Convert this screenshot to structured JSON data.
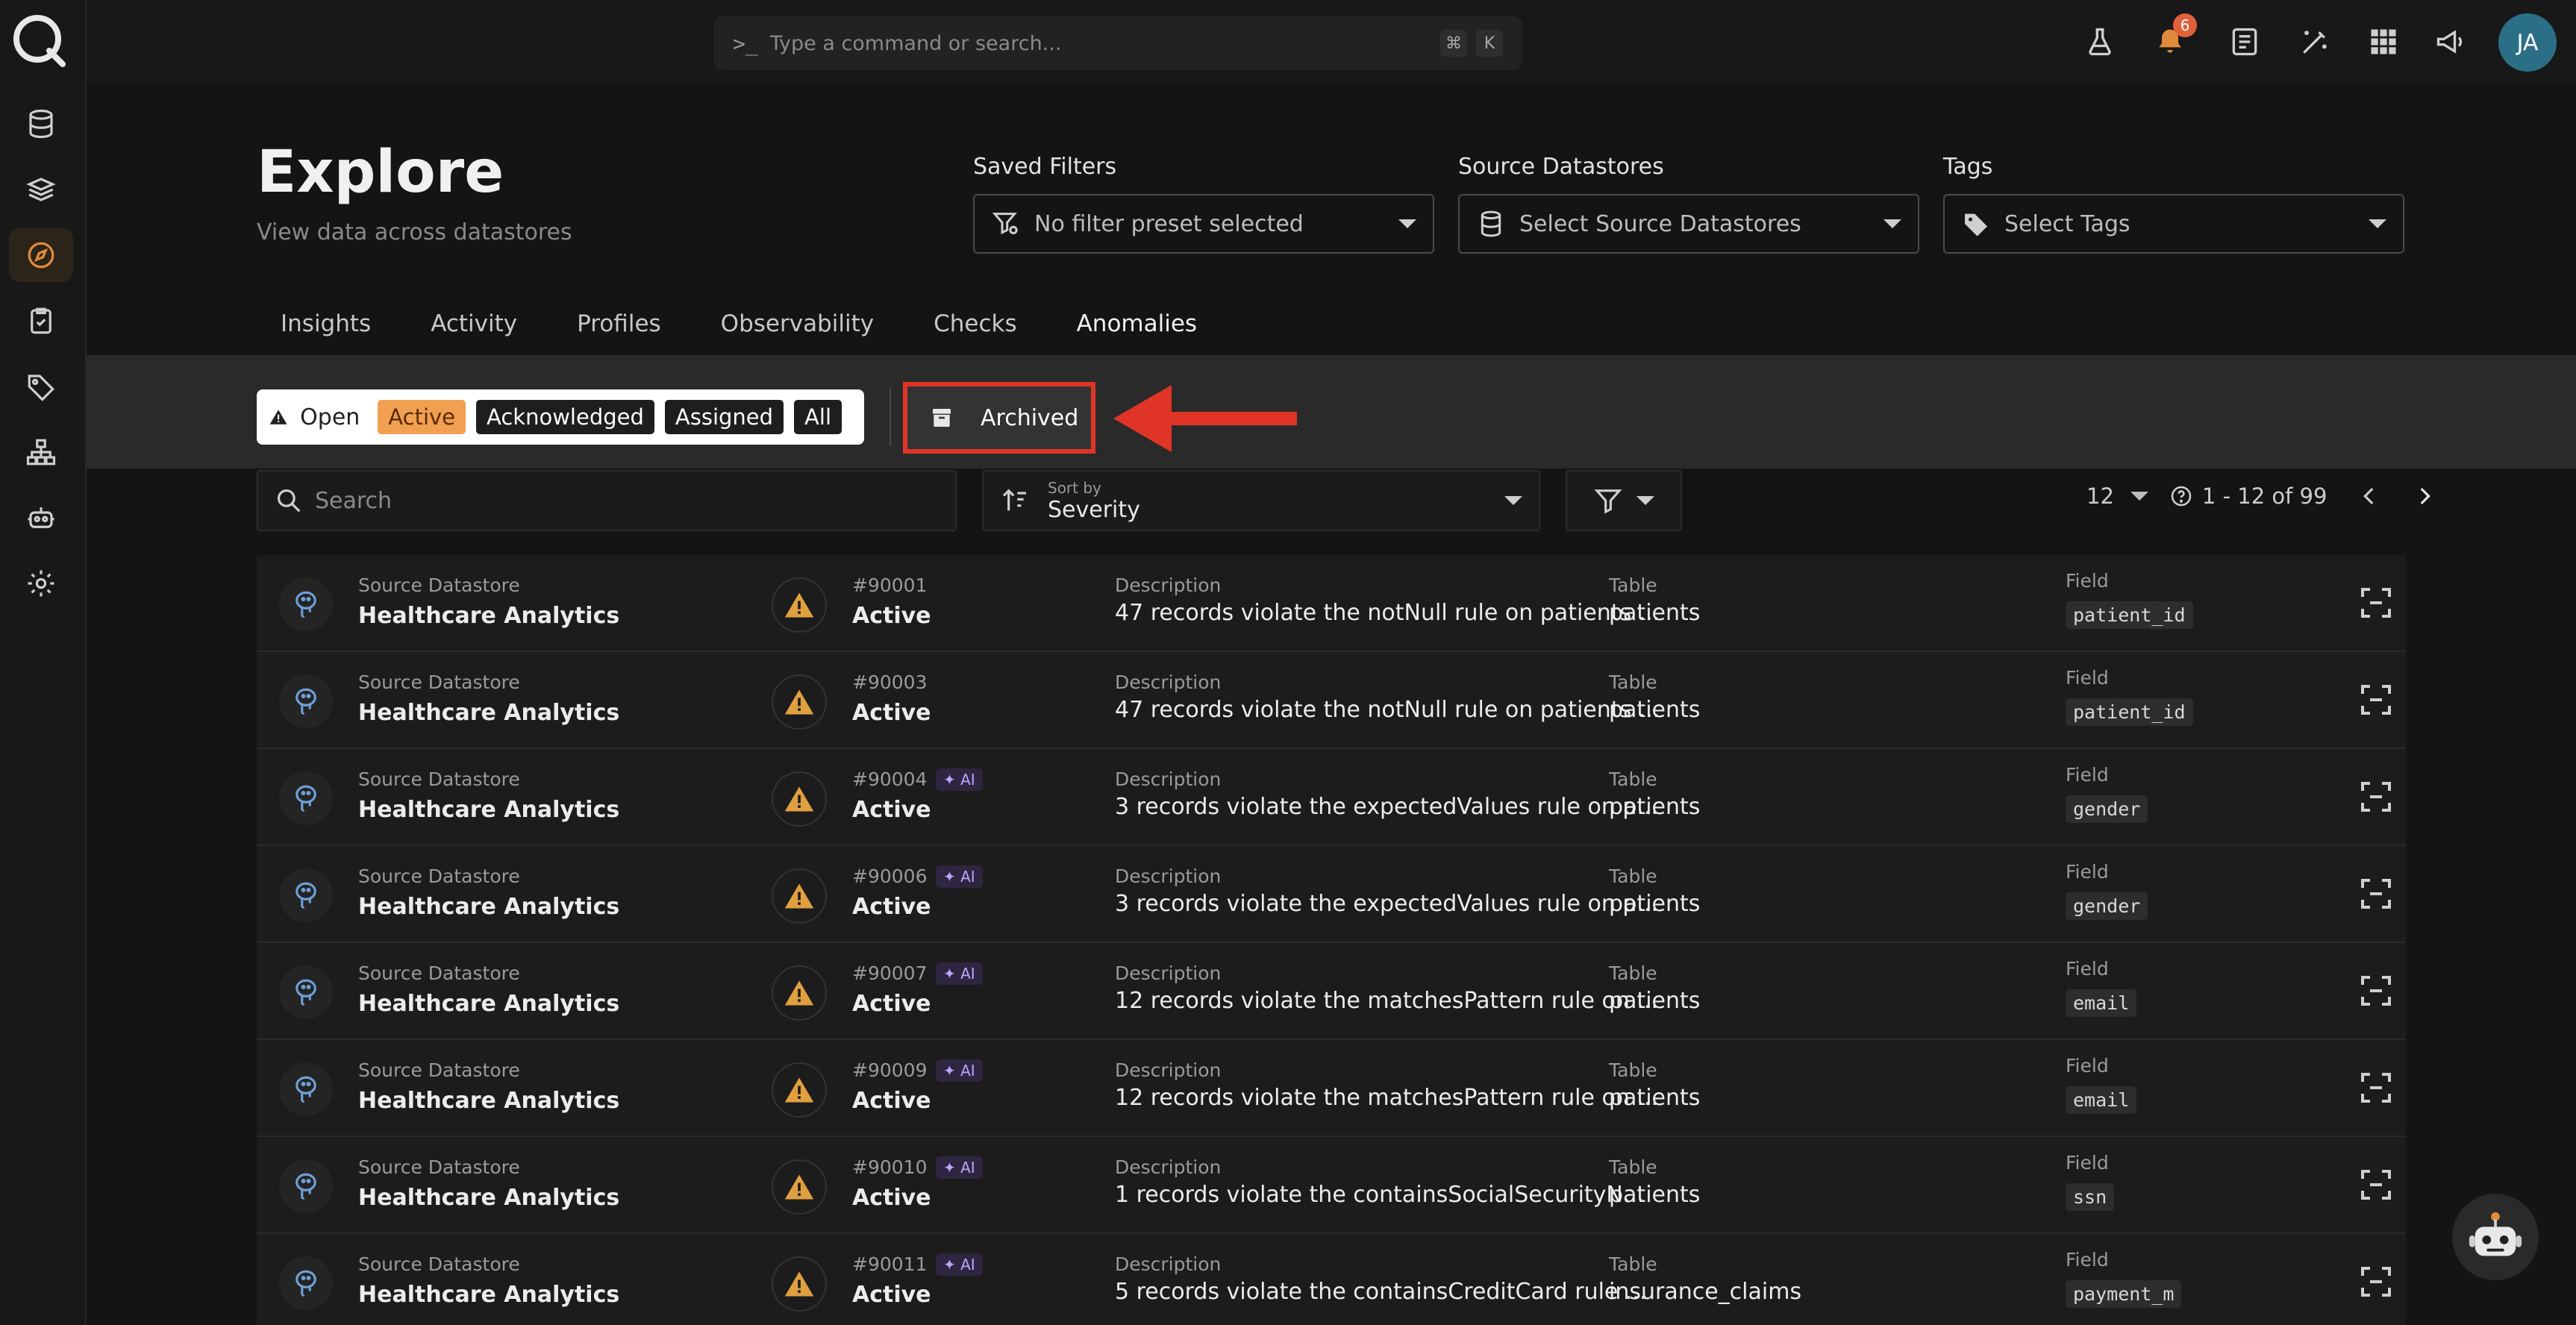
{
  "command_bar": {
    "prompt": ">_",
    "placeholder": "Type a command or search...",
    "shortcut_mod": "⌘",
    "shortcut_key": "K"
  },
  "notifications": {
    "count": "6"
  },
  "user": {
    "initials": "JA"
  },
  "sidebar": {
    "items": [
      {
        "name": "datastores",
        "icon": "database-icon"
      },
      {
        "name": "flows",
        "icon": "layers-icon"
      },
      {
        "name": "explore",
        "icon": "compass-icon",
        "active": true
      },
      {
        "name": "checks",
        "icon": "clipboard-check-icon"
      },
      {
        "name": "tags",
        "icon": "tag-icon"
      },
      {
        "name": "hierarchy",
        "icon": "sitemap-icon"
      },
      {
        "name": "agents",
        "icon": "robot-icon"
      },
      {
        "name": "settings",
        "icon": "gear-icon"
      }
    ]
  },
  "header": {
    "title": "Explore",
    "subtitle": "View data across datastores"
  },
  "filters": {
    "saved": {
      "label": "Saved Filters",
      "placeholder": "No filter preset selected"
    },
    "source": {
      "label": "Source Datastores",
      "placeholder": "Select Source Datastores"
    },
    "tags": {
      "label": "Tags",
      "placeholder": "Select Tags"
    }
  },
  "tabs": [
    "Insights",
    "Activity",
    "Profiles",
    "Observability",
    "Checks",
    "Anomalies"
  ],
  "active_tab": "Anomalies",
  "status_filter": {
    "open_label": "Open",
    "chips": [
      "Active",
      "Acknowledged",
      "Assigned",
      "All"
    ],
    "active": "Active"
  },
  "archived_label": "Archived",
  "search": {
    "placeholder": "Search"
  },
  "sort": {
    "label": "Sort by",
    "value": "Severity"
  },
  "pagination": {
    "per_page": "12",
    "range": "1 - 12 of 99"
  },
  "table": {
    "labels": {
      "source": "Source Datastore",
      "description": "Description",
      "table": "Table",
      "field": "Field",
      "ai": "✦ AI"
    },
    "rows": [
      {
        "source": "Healthcare Analytics",
        "id": "#90001",
        "status": "Active",
        "ai": false,
        "description": "47 records violate the notNull rule on patients ...",
        "table": "patients",
        "field": "patient_id"
      },
      {
        "source": "Healthcare Analytics",
        "id": "#90003",
        "status": "Active",
        "ai": false,
        "description": "47 records violate the notNull rule on patients ...",
        "table": "patients",
        "field": "patient_id"
      },
      {
        "source": "Healthcare Analytics",
        "id": "#90004",
        "status": "Active",
        "ai": true,
        "description": "3 records violate the expectedValues rule on p...",
        "table": "patients",
        "field": "gender"
      },
      {
        "source": "Healthcare Analytics",
        "id": "#90006",
        "status": "Active",
        "ai": true,
        "description": "3 records violate the expectedValues rule on p...",
        "table": "patients",
        "field": "gender"
      },
      {
        "source": "Healthcare Analytics",
        "id": "#90007",
        "status": "Active",
        "ai": true,
        "description": "12 records violate the matchesPattern rule on ...",
        "table": "patients",
        "field": "email"
      },
      {
        "source": "Healthcare Analytics",
        "id": "#90009",
        "status": "Active",
        "ai": true,
        "description": "12 records violate the matchesPattern rule on ...",
        "table": "patients",
        "field": "email"
      },
      {
        "source": "Healthcare Analytics",
        "id": "#90010",
        "status": "Active",
        "ai": true,
        "description": "1 records violate the containsSocialSecurityN...",
        "table": "patients",
        "field": "ssn"
      },
      {
        "source": "Healthcare Analytics",
        "id": "#90011",
        "status": "Active",
        "ai": true,
        "description": "5 records violate the containsCreditCard rule ...",
        "table": "insurance_claims",
        "field": "payment_m"
      }
    ]
  },
  "colors": {
    "accent": "#e08a3c",
    "highlight": "#e03526",
    "warning": "#e0a040"
  }
}
